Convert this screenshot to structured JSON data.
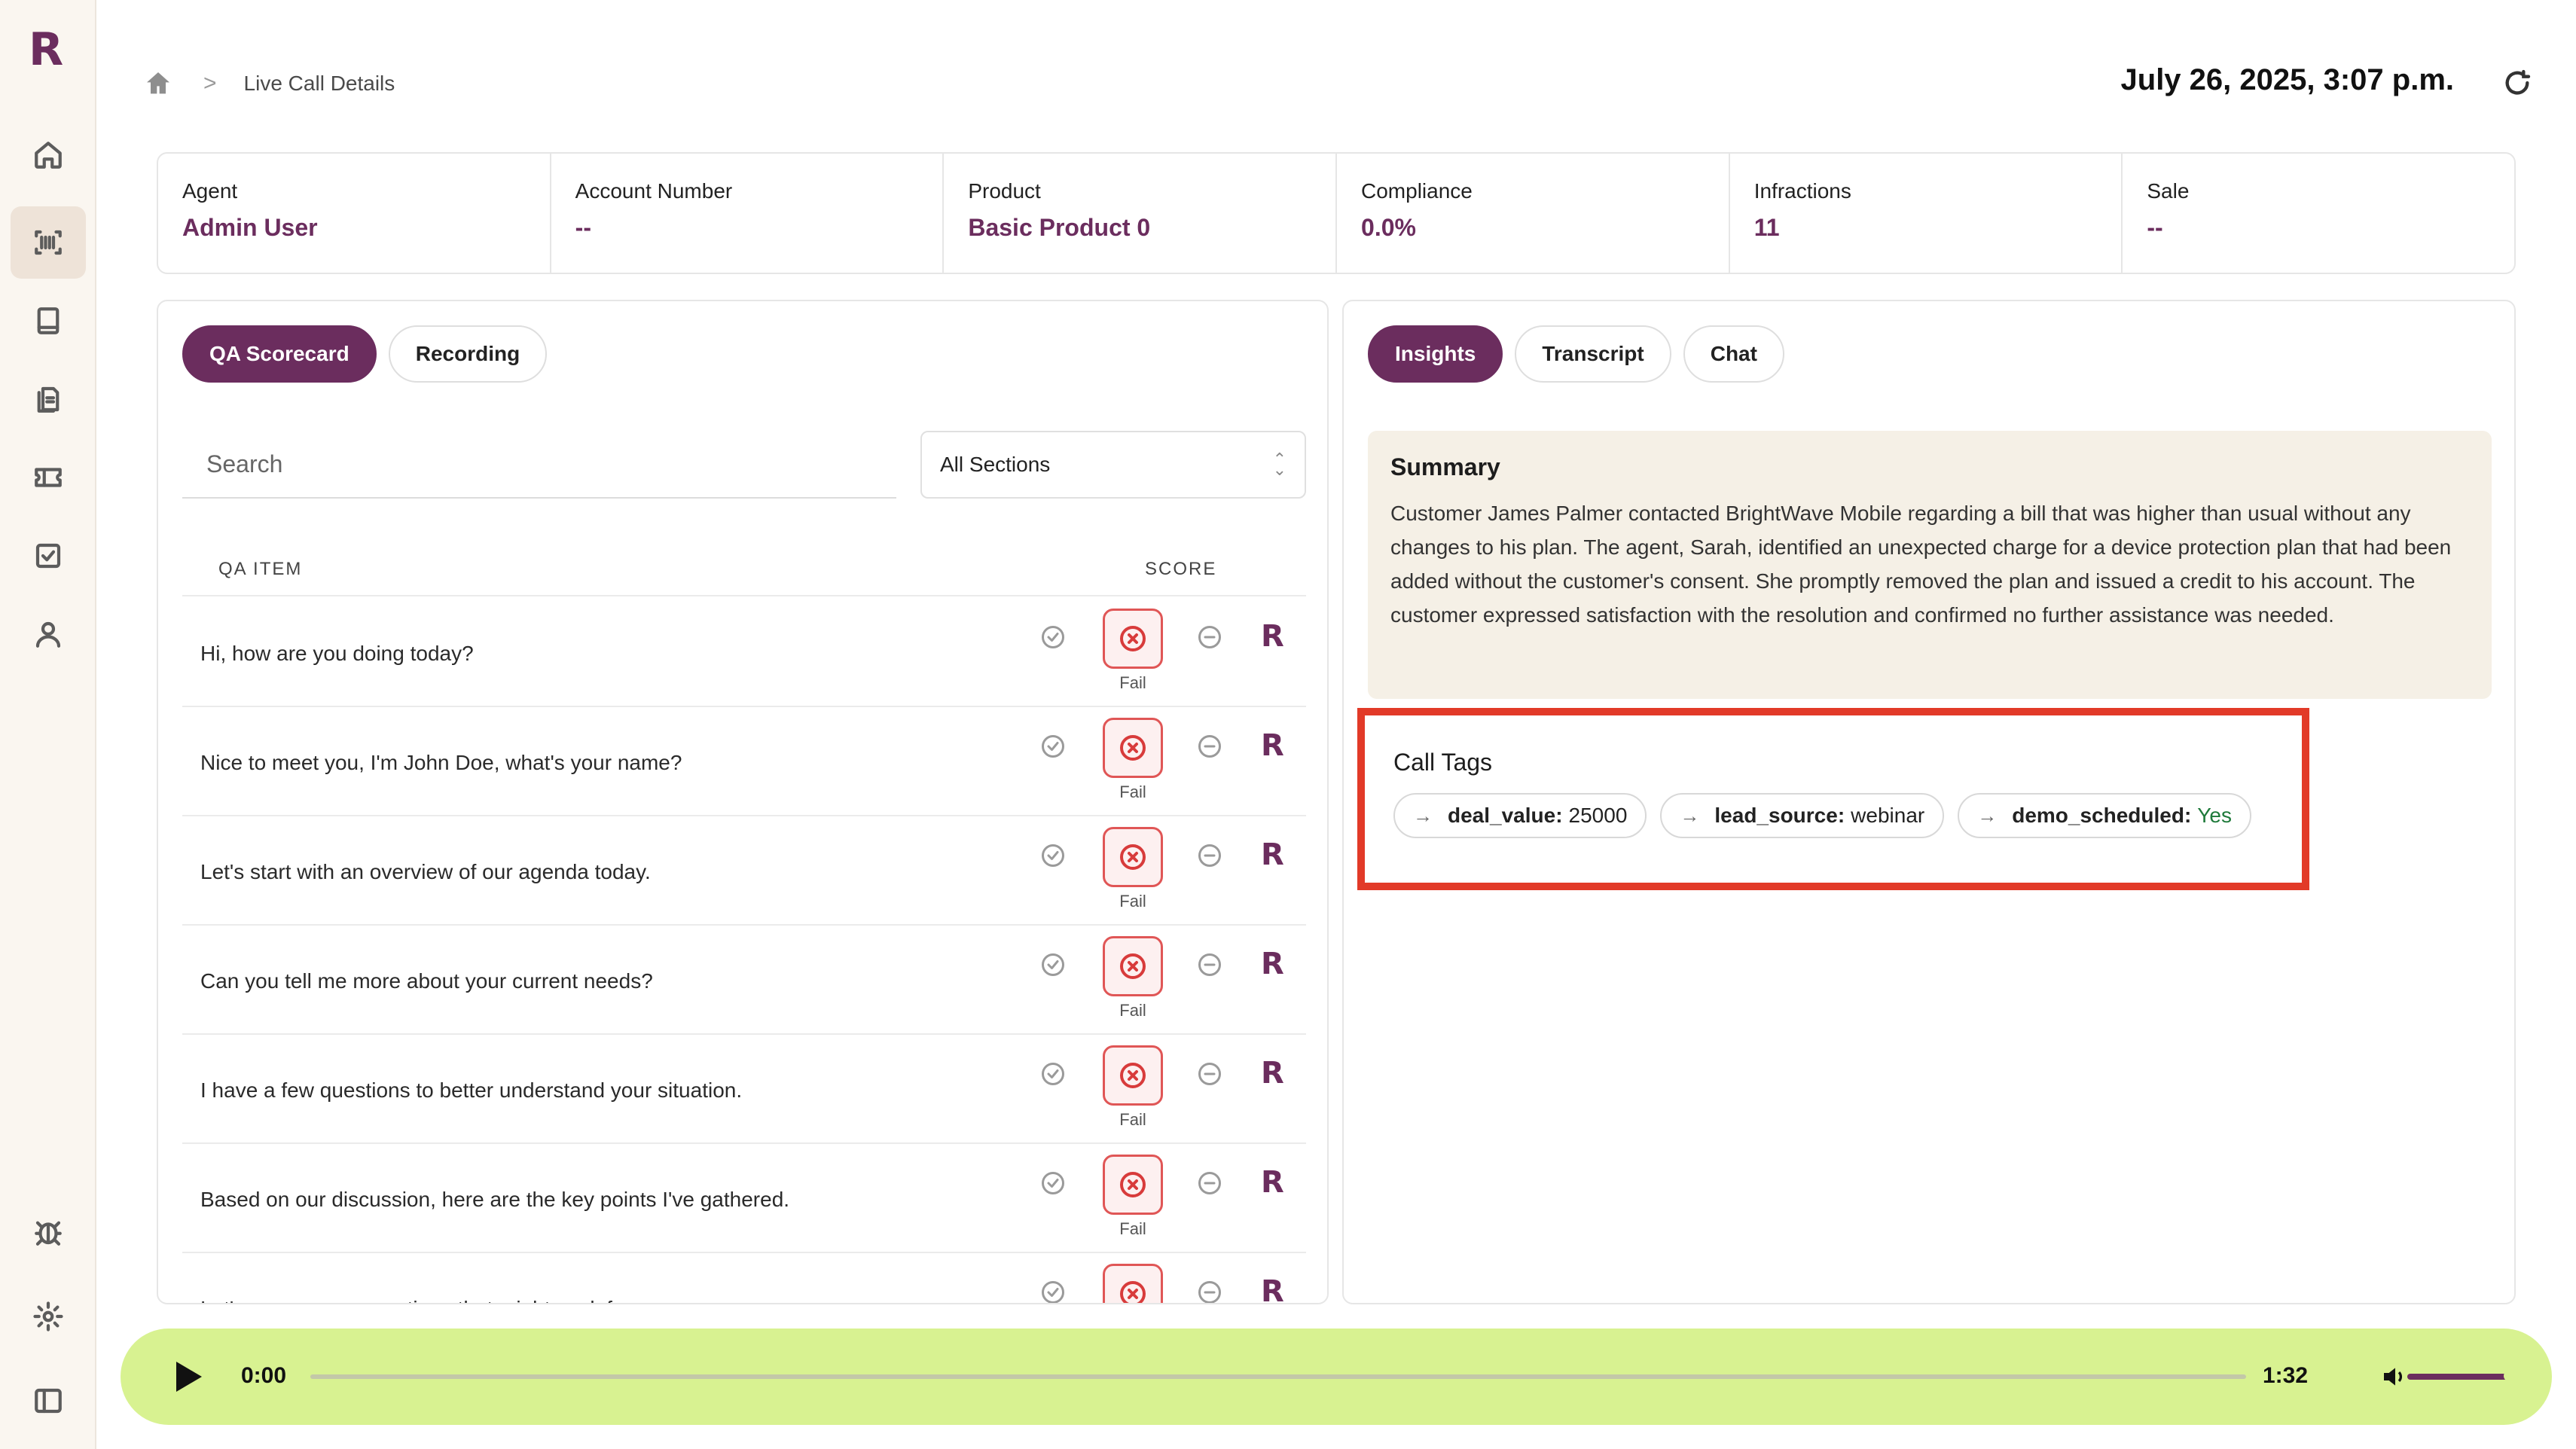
{
  "app": {
    "logo": "R"
  },
  "sidebar": {
    "items": [
      {
        "icon": "home-icon"
      },
      {
        "icon": "barcode-scan-icon",
        "active": true
      },
      {
        "icon": "book-icon"
      },
      {
        "icon": "documents-icon"
      },
      {
        "icon": "ticket-icon"
      },
      {
        "icon": "checkbox-icon"
      },
      {
        "icon": "user-icon"
      }
    ],
    "bottom": [
      {
        "icon": "bug-icon"
      },
      {
        "icon": "gear-icon"
      },
      {
        "icon": "sidebar-toggle-icon"
      }
    ]
  },
  "header": {
    "breadcrumb_current": "Live Call Details",
    "breadcrumb_separator": ">",
    "datetime": "July 26, 2025, 3:07 p.m."
  },
  "stats": [
    {
      "label": "Agent",
      "value": "Admin User"
    },
    {
      "label": "Account Number",
      "value": "--"
    },
    {
      "label": "Product",
      "value": "Basic Product 0"
    },
    {
      "label": "Compliance",
      "value": "0.0%"
    },
    {
      "label": "Infractions",
      "value": "11"
    },
    {
      "label": "Sale",
      "value": "--"
    }
  ],
  "left_panel": {
    "tabs": [
      {
        "label": "QA Scorecard",
        "active": true
      },
      {
        "label": "Recording",
        "active": false
      }
    ],
    "search_placeholder": "Search",
    "section_select": "All Sections",
    "columns": {
      "item": "QA ITEM",
      "score": "SCORE"
    },
    "rows": [
      {
        "question": "Hi, how are you doing today?",
        "result": "Fail"
      },
      {
        "question": "Nice to meet you, I'm John Doe, what's your name?",
        "result": "Fail"
      },
      {
        "question": "Let's start with an overview of our agenda today.",
        "result": "Fail"
      },
      {
        "question": "Can you tell me more about your current needs?",
        "result": "Fail"
      },
      {
        "question": "I have a few questions to better understand your situation.",
        "result": "Fail"
      },
      {
        "question": "Based on our discussion, here are the key points I've gathered.",
        "result": "Fail"
      },
      {
        "question": "Let's go over some options that might work for you.",
        "result": "Fail"
      }
    ],
    "reviewer_mark": "R"
  },
  "right_panel": {
    "tabs": [
      {
        "label": "Insights",
        "active": true
      },
      {
        "label": "Transcript",
        "active": false
      },
      {
        "label": "Chat",
        "active": false
      }
    ],
    "summary": {
      "title": "Summary",
      "text": "Customer James Palmer contacted BrightWave Mobile regarding a bill that was higher than usual without any changes to his plan. The agent, Sarah, identified an unexpected charge for a device protection plan that had been added without the customer's consent. She promptly removed the plan and issued a credit to his account. The customer expressed satisfaction with the resolution and confirmed no further assistance was needed."
    },
    "call_tags": {
      "title": "Call Tags",
      "tags": [
        {
          "key": "deal_value:",
          "value": "25000"
        },
        {
          "key": "lead_source:",
          "value": "webinar"
        },
        {
          "key": "demo_scheduled:",
          "value": "Yes"
        }
      ]
    }
  },
  "player": {
    "current_time": "0:00",
    "duration": "1:32",
    "progress": 0,
    "volume": 1.0
  },
  "colors": {
    "brand": "#6b2d5e",
    "player_bg": "#d8f291",
    "fail": "#e05656",
    "highlight": "#e23a28"
  }
}
